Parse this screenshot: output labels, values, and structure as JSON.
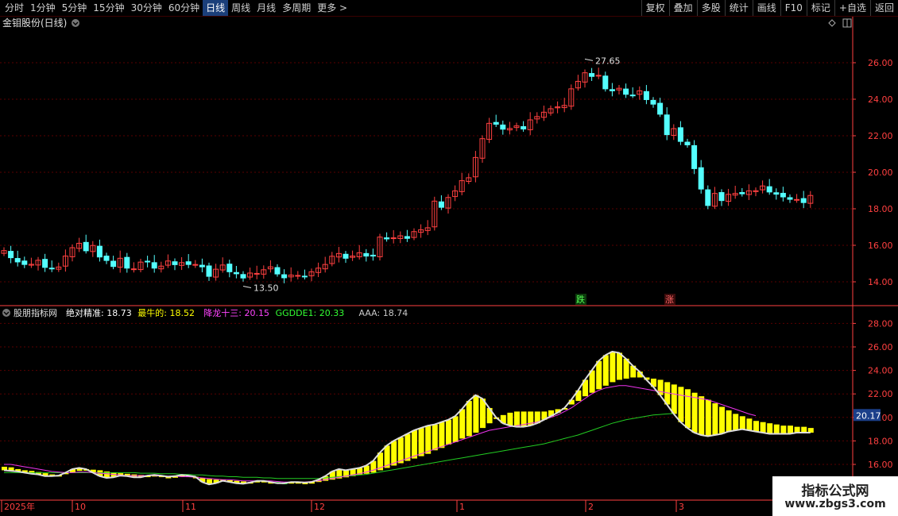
{
  "toolbar": {
    "left_items": [
      "分时",
      "1分钟",
      "5分钟",
      "15分钟",
      "30分钟",
      "60分钟",
      "日线",
      "周线",
      "月线",
      "多周期",
      "更多 >"
    ],
    "active": "日线",
    "right_items": [
      "复权",
      "叠加",
      "多股",
      "统计",
      "画线",
      "F10",
      "标记",
      "+自选",
      "返回"
    ]
  },
  "main_panel": {
    "title": "金钼股份(日线)",
    "y_ticks": [
      "26.00",
      "24.00",
      "22.00",
      "20.00",
      "18.00",
      "16.00",
      "14.00"
    ],
    "high_label": "27.65",
    "low_label": "13.50",
    "signal_die": "跌",
    "signal_zhang": "涨"
  },
  "indicator_panel": {
    "title": "股朋指标网",
    "labels": [
      {
        "name": "绝对精准:",
        "value": "18.73",
        "color": "#ffffff"
      },
      {
        "name": "最牛的:",
        "value": "18.52",
        "color": "#ffff00"
      },
      {
        "name": "降龙十三:",
        "value": "20.15",
        "color": "#ff44ff"
      },
      {
        "name": "GGDDE1:",
        "value": "20.33",
        "color": "#33ff33"
      },
      {
        "name": "AAA:",
        "value": "18.74",
        "color": "#c8c8c8"
      }
    ],
    "y_ticks": [
      "28.00",
      "26.00",
      "24.00",
      "22.00",
      "20.00",
      "18.00",
      "16.00"
    ],
    "current_value": "20.17"
  },
  "x_axis": {
    "labels": [
      "2025年",
      "10",
      "11",
      "12",
      "1",
      "2",
      "3"
    ]
  },
  "watermark": {
    "line1": "指标公式网",
    "line2": "www.zbgs3.com"
  },
  "colors": {
    "up": "#ff4040",
    "down": "#54ffff",
    "grid": "#5a0000",
    "axis": "#ff4040",
    "yellow": "#ffff00",
    "green": "#22ff22"
  },
  "chart_data": {
    "type": "candlestick",
    "close": [
      15.71,
      15.32,
      15.09,
      14.95,
      14.96,
      15.18,
      14.79,
      14.73,
      14.81,
      15.41,
      15.87,
      16.11,
      15.7,
      15.99,
      15.36,
      15.17,
      14.84,
      15.29,
      14.75,
      14.71,
      15.08,
      15.09,
      14.75,
      14.86,
      15.14,
      14.94,
      15.05,
      14.95,
      14.95,
      14.82,
      14.3,
      14.69,
      14.92,
      14.55,
      14.44,
      14.21,
      14.48,
      14.46,
      14.66,
      14.82,
      14.43,
      14.22,
      14.37,
      14.35,
      14.28,
      14.55,
      14.75,
      14.95,
      15.4,
      15.55,
      15.29,
      15.41,
      15.59,
      15.41,
      15.41,
      16.45,
      16.35,
      16.41,
      16.52,
      16.38,
      16.75,
      16.85,
      16.96,
      18.42,
      18.08,
      18.62,
      18.98,
      19.54,
      19.7,
      20.81,
      21.84,
      22.68,
      22.63,
      22.36,
      22.4,
      22.54,
      22.37,
      22.87,
      23.05,
      23.29,
      23.48,
      23.58,
      23.66,
      24.57,
      24.98,
      25.45,
      25.25,
      25.31,
      24.57,
      24.46,
      24.6,
      24.27,
      24.22,
      24.46,
      23.98,
      23.73,
      23.18,
      22.06,
      22.39,
      21.69,
      21.5,
      20.2,
      19.08,
      18.18,
      18.84,
      18.45,
      18.79,
      18.84,
      18.82,
      18.98,
      18.99,
      19.25,
      18.92,
      18.8,
      18.65,
      18.52,
      18.51,
      18.34,
      18.73
    ],
    "ma_yellow": [
      15.8,
      15.75,
      15.6,
      15.5,
      15.45,
      15.35,
      15.25,
      15.15,
      15.1,
      15.2,
      15.3,
      15.45,
      15.5,
      15.55,
      15.5,
      15.4,
      15.3,
      15.25,
      15.2,
      15.15,
      15.1,
      15.05,
      15.0,
      14.95,
      14.95,
      14.95,
      14.95,
      14.95,
      14.9,
      14.85,
      14.75,
      14.7,
      14.7,
      14.65,
      14.6,
      14.55,
      14.5,
      14.5,
      14.5,
      14.5,
      14.5,
      14.45,
      14.4,
      14.4,
      14.4,
      14.45,
      14.5,
      14.6,
      14.7,
      14.8,
      14.9,
      15.0,
      15.1,
      15.2,
      15.3,
      15.5,
      15.7,
      15.9,
      16.1,
      16.3,
      16.5,
      16.7,
      16.9,
      17.2,
      17.4,
      17.7,
      17.9,
      18.2,
      18.4,
      18.7,
      19.1,
      19.5,
      19.9,
      20.2,
      20.4,
      20.5,
      20.5,
      20.5,
      20.5,
      20.5,
      20.6,
      20.7,
      20.8,
      21.1,
      21.4,
      21.8,
      22.1,
      22.4,
      22.7,
      23.0,
      23.2,
      23.3,
      23.4,
      23.4,
      23.4,
      23.3,
      23.2,
      23.0,
      22.8,
      22.6,
      22.4,
      22.1,
      21.8,
      21.5,
      21.2,
      20.9,
      20.6,
      20.3,
      20.1,
      19.9,
      19.7,
      19.6,
      19.5,
      19.4,
      19.3,
      19.3,
      19.2,
      19.2,
      19.1
    ],
    "ma_white": [
      15.5,
      15.45,
      15.4,
      15.3,
      15.2,
      15.15,
      15.0,
      15.0,
      15.05,
      15.3,
      15.6,
      15.7,
      15.6,
      15.3,
      15.0,
      14.85,
      14.9,
      15.05,
      15.0,
      14.9,
      14.9,
      15.05,
      15.1,
      15.05,
      14.95,
      15.0,
      15.1,
      15.05,
      14.95,
      14.5,
      14.3,
      14.4,
      14.6,
      14.5,
      14.4,
      14.35,
      14.45,
      14.6,
      14.6,
      14.5,
      14.4,
      14.4,
      14.5,
      14.5,
      14.45,
      14.5,
      14.7,
      15.0,
      15.4,
      15.6,
      15.5,
      15.6,
      15.7,
      15.9,
      16.3,
      17.0,
      17.6,
      18.0,
      18.3,
      18.6,
      18.9,
      19.1,
      19.3,
      19.4,
      19.6,
      19.8,
      20.1,
      20.7,
      21.4,
      21.9,
      21.6,
      20.8,
      20.0,
      19.5,
      19.3,
      19.2,
      19.2,
      19.3,
      19.5,
      19.8,
      20.1,
      20.4,
      20.8,
      21.5,
      22.3,
      23.2,
      24.0,
      24.8,
      25.3,
      25.6,
      25.5,
      25.0,
      24.4,
      23.9,
      23.2,
      22.6,
      21.9,
      21.1,
      20.3,
      19.6,
      19.1,
      18.7,
      18.5,
      18.4,
      18.5,
      18.6,
      18.8,
      18.9,
      19.0,
      18.9,
      18.8,
      18.7,
      18.6,
      18.6,
      18.6,
      18.6,
      18.7,
      18.7,
      18.7
    ],
    "ma_magenta": [
      16.0,
      16.0,
      15.9,
      15.8,
      15.7,
      15.6,
      15.5,
      15.4,
      15.35,
      15.3,
      15.3,
      15.35,
      15.35,
      15.3,
      15.25,
      15.2,
      15.15,
      15.1,
      15.05,
      15.05,
      15.05,
      15.05,
      15.05,
      15.0,
      15.0,
      15.0,
      14.95,
      14.95,
      14.9,
      14.85,
      14.8,
      14.75,
      14.7,
      14.7,
      14.65,
      14.6,
      14.6,
      14.6,
      14.6,
      14.6,
      14.55,
      14.5,
      14.5,
      14.5,
      14.5,
      14.55,
      14.6,
      14.7,
      14.8,
      14.9,
      15.0,
      15.1,
      15.2,
      15.35,
      15.5,
      15.7,
      15.9,
      16.1,
      16.3,
      16.5,
      16.7,
      16.9,
      17.1,
      17.3,
      17.5,
      17.7,
      17.9,
      18.1,
      18.3,
      18.5,
      18.7,
      18.9,
      19.0,
      19.1,
      19.2,
      19.3,
      19.4,
      19.5,
      19.6,
      19.8,
      20.0,
      20.2,
      20.5,
      20.8,
      21.2,
      21.6,
      22.0,
      22.3,
      22.5,
      22.6,
      22.7,
      22.7,
      22.6,
      22.5,
      22.4,
      22.3,
      22.2,
      22.1,
      22.0,
      21.9,
      21.8,
      21.7,
      21.6,
      21.5,
      21.3,
      21.1,
      20.9,
      20.7,
      20.5,
      20.3,
      20.15
    ],
    "ma_green": [
      15.3,
      15.3,
      15.3,
      15.3,
      15.3,
      15.3,
      15.3,
      15.3,
      15.3,
      15.3,
      15.3,
      15.3,
      15.3,
      15.3,
      15.3,
      15.3,
      15.3,
      15.3,
      15.3,
      15.3,
      15.25,
      15.25,
      15.25,
      15.2,
      15.2,
      15.2,
      15.15,
      15.15,
      15.1,
      15.1,
      15.05,
      15.0,
      15.0,
      14.95,
      14.95,
      14.9,
      14.9,
      14.9,
      14.85,
      14.85,
      14.8,
      14.8,
      14.8,
      14.8,
      14.8,
      14.8,
      14.8,
      14.85,
      14.9,
      14.95,
      15.0,
      15.05,
      15.1,
      15.15,
      15.25,
      15.35,
      15.45,
      15.55,
      15.65,
      15.75,
      15.85,
      15.95,
      16.05,
      16.15,
      16.25,
      16.35,
      16.45,
      16.55,
      16.65,
      16.75,
      16.85,
      16.95,
      17.05,
      17.15,
      17.25,
      17.35,
      17.45,
      17.55,
      17.65,
      17.75,
      17.9,
      18.05,
      18.2,
      18.35,
      18.5,
      18.7,
      18.9,
      19.1,
      19.3,
      19.5,
      19.65,
      19.8,
      19.9,
      20.0,
      20.1,
      20.2,
      20.25,
      20.3,
      20.33
    ]
  }
}
